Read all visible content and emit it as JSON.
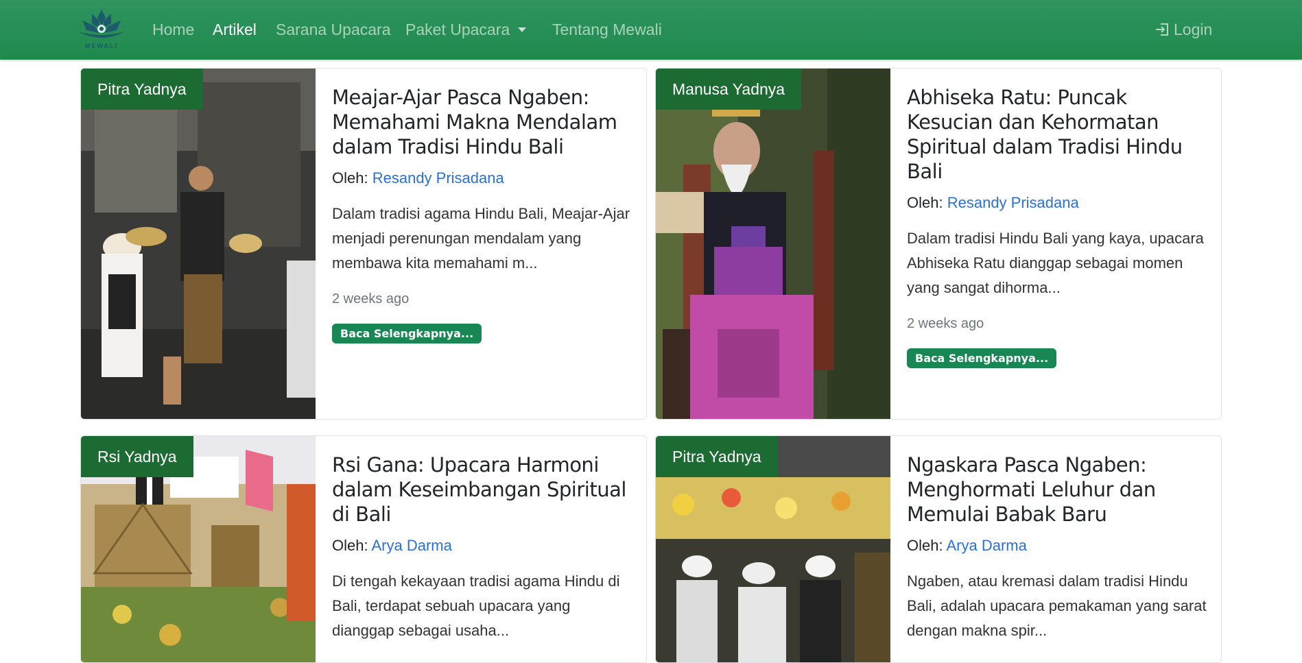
{
  "nav": {
    "logo_text": "MEWALI",
    "items": [
      "Home",
      "Artikel",
      "Sarana Upacara",
      "Paket Upacara",
      "Tentang Mewali"
    ],
    "login": "Login"
  },
  "articles": [
    {
      "category": "Pitra Yadnya",
      "title": "Meajar-Ajar Pasca Ngaben: Memahami Makna Mendalam dalam Tradisi Hindu Bali",
      "author_prefix": "Oleh:",
      "author": "Resandy Prisadana",
      "excerpt": "Dalam tradisi agama Hindu Bali, Meajar-Ajar menjadi perenungan mendalam yang membawa kita memahami m...",
      "time": "2 weeks ago",
      "button": "Baca Selengkapnya..."
    },
    {
      "category": "Manusa Yadnya",
      "title": "Abhiseka Ratu: Puncak Kesucian dan Kehormatan Spiritual dalam Tradisi Hindu Bali",
      "author_prefix": "Oleh:",
      "author": "Resandy Prisadana",
      "excerpt": "Dalam tradisi Hindu Bali yang kaya, upacara Abhiseka Ratu dianggap sebagai momen yang sangat dihorma...",
      "time": "2 weeks ago",
      "button": "Baca Selengkapnya..."
    },
    {
      "category": "Rsi Yadnya",
      "title": "Rsi Gana: Upacara Harmoni dalam Keseimbangan Spiritual di Bali",
      "author_prefix": "Oleh:",
      "author": "Arya Darma",
      "excerpt": "Di tengah kekayaan tradisi agama Hindu di Bali, terdapat sebuah upacara yang dianggap sebagai usaha...",
      "time": "",
      "button": ""
    },
    {
      "category": "Pitra Yadnya",
      "title": "Ngaskara Pasca Ngaben: Menghormati Leluhur dan Memulai Babak Baru",
      "author_prefix": "Oleh:",
      "author": "Arya Darma",
      "excerpt": "Ngaben, atau kremasi dalam tradisi Hindu Bali, adalah upacara pemakaman yang sarat dengan makna spir...",
      "time": "",
      "button": ""
    }
  ],
  "colors": {
    "navbar": "#1f8a4c",
    "badge": "#1c6b32",
    "button": "#198754",
    "link": "#2a6fdb"
  }
}
